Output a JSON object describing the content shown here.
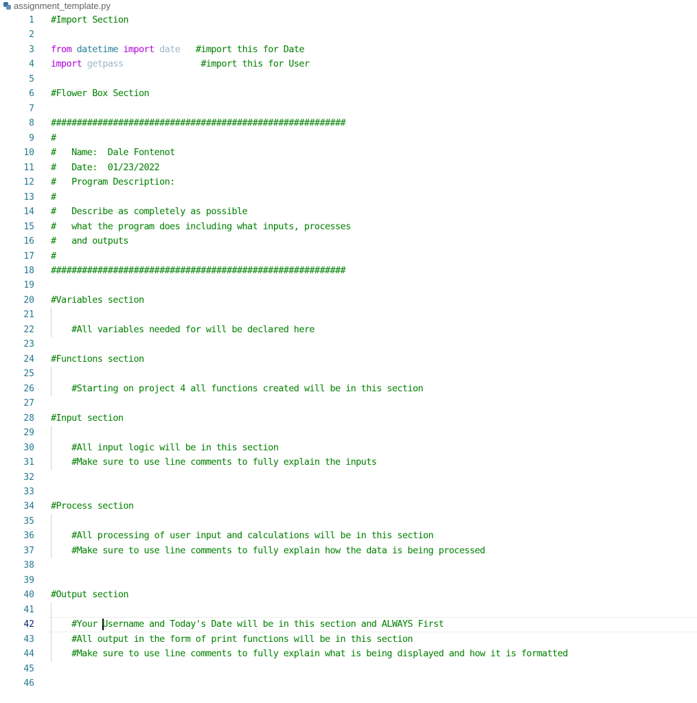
{
  "tab": {
    "icon": "python-file-icon",
    "title": "assignment_template.py"
  },
  "colors": {
    "comment": "#008000",
    "keyword": "#af00db",
    "module": "#267f99",
    "line_number": "#237893"
  },
  "cursor": {
    "line": 42,
    "column": 10
  },
  "lines": [
    {
      "n": "1",
      "parts": [
        {
          "t": "#Import Section",
          "c": "cmt"
        }
      ]
    },
    {
      "n": "2",
      "parts": []
    },
    {
      "n": "3",
      "parts": [
        {
          "t": "from",
          "c": "kw"
        },
        {
          "t": " datetime ",
          "c": "mod"
        },
        {
          "t": "import",
          "c": "kw"
        },
        {
          "t": " ",
          "c": ""
        },
        {
          "t": "date",
          "c": "dim"
        },
        {
          "t": "   ",
          "c": ""
        },
        {
          "t": "#import this for Date",
          "c": "cmt"
        }
      ]
    },
    {
      "n": "4",
      "parts": [
        {
          "t": "import",
          "c": "kw"
        },
        {
          "t": " ",
          "c": ""
        },
        {
          "t": "getpass",
          "c": "dim"
        },
        {
          "t": "               ",
          "c": ""
        },
        {
          "t": "#import this for User",
          "c": "cmt"
        }
      ]
    },
    {
      "n": "5",
      "parts": []
    },
    {
      "n": "6",
      "parts": [
        {
          "t": "#Flower Box Section",
          "c": "cmt"
        }
      ]
    },
    {
      "n": "7",
      "parts": []
    },
    {
      "n": "8",
      "parts": [
        {
          "t": "#########################################################",
          "c": "cmt"
        }
      ]
    },
    {
      "n": "9",
      "parts": [
        {
          "t": "#",
          "c": "cmt"
        }
      ]
    },
    {
      "n": "10",
      "parts": [
        {
          "t": "#   Name:  Dale Fontenot",
          "c": "cmt"
        }
      ]
    },
    {
      "n": "11",
      "parts": [
        {
          "t": "#   Date:  01/23/2022",
          "c": "cmt"
        }
      ]
    },
    {
      "n": "12",
      "parts": [
        {
          "t": "#   Program Description:",
          "c": "cmt"
        }
      ]
    },
    {
      "n": "13",
      "parts": [
        {
          "t": "#",
          "c": "cmt"
        }
      ]
    },
    {
      "n": "14",
      "parts": [
        {
          "t": "#   Describe as completely as possible",
          "c": "cmt"
        }
      ]
    },
    {
      "n": "15",
      "parts": [
        {
          "t": "#   what the program does including what inputs, processes",
          "c": "cmt"
        }
      ]
    },
    {
      "n": "16",
      "parts": [
        {
          "t": "#   and outputs",
          "c": "cmt"
        }
      ]
    },
    {
      "n": "17",
      "parts": [
        {
          "t": "#",
          "c": "cmt"
        }
      ]
    },
    {
      "n": "18",
      "parts": [
        {
          "t": "#########################################################",
          "c": "cmt"
        }
      ]
    },
    {
      "n": "19",
      "parts": []
    },
    {
      "n": "20",
      "parts": [
        {
          "t": "#Variables section",
          "c": "cmt"
        }
      ]
    },
    {
      "n": "21",
      "parts": [],
      "guide": true
    },
    {
      "n": "22",
      "parts": [
        {
          "t": "    #All variables needed for will be declared here",
          "c": "cmt"
        }
      ],
      "guide": true
    },
    {
      "n": "23",
      "parts": []
    },
    {
      "n": "24",
      "parts": [
        {
          "t": "#Functions section",
          "c": "cmt"
        }
      ]
    },
    {
      "n": "25",
      "parts": [],
      "guide": true
    },
    {
      "n": "26",
      "parts": [
        {
          "t": "    #Starting on project 4 all functions created will be in this section",
          "c": "cmt"
        }
      ],
      "guide": true
    },
    {
      "n": "27",
      "parts": []
    },
    {
      "n": "28",
      "parts": [
        {
          "t": "#Input section",
          "c": "cmt"
        }
      ]
    },
    {
      "n": "29",
      "parts": [],
      "guide": true
    },
    {
      "n": "30",
      "parts": [
        {
          "t": "    #All input logic will be in this section",
          "c": "cmt"
        }
      ],
      "guide": true
    },
    {
      "n": "31",
      "parts": [
        {
          "t": "    #Make sure to use line comments to fully explain the inputs",
          "c": "cmt"
        }
      ],
      "guide": true
    },
    {
      "n": "32",
      "parts": []
    },
    {
      "n": "33",
      "parts": []
    },
    {
      "n": "34",
      "parts": [
        {
          "t": "#Process section",
          "c": "cmt"
        }
      ]
    },
    {
      "n": "35",
      "parts": [],
      "guide": true
    },
    {
      "n": "36",
      "parts": [
        {
          "t": "    #All processing of user input and calculations will be in this section",
          "c": "cmt"
        }
      ],
      "guide": true
    },
    {
      "n": "37",
      "parts": [
        {
          "t": "    #Make sure to use line comments to fully explain how the data is being processed",
          "c": "cmt"
        }
      ],
      "guide": true
    },
    {
      "n": "38",
      "parts": []
    },
    {
      "n": "39",
      "parts": []
    },
    {
      "n": "40",
      "parts": [
        {
          "t": "#Output section",
          "c": "cmt"
        }
      ]
    },
    {
      "n": "41",
      "parts": [],
      "guide": true
    },
    {
      "n": "42",
      "parts": [
        {
          "t": "    #Your ",
          "c": "cmt"
        },
        {
          "t": "",
          "c": "cursor"
        },
        {
          "t": "Username and Today's Date will be in this section and ALWAYS First",
          "c": "cmt"
        }
      ],
      "guide": true,
      "active": true
    },
    {
      "n": "43",
      "parts": [
        {
          "t": "    #All output in the form of print functions will be in this section",
          "c": "cmt"
        }
      ],
      "guide": true
    },
    {
      "n": "44",
      "parts": [
        {
          "t": "    #Make sure to use line comments to fully explain what is being displayed and how it is formatted",
          "c": "cmt"
        }
      ],
      "guide": true
    },
    {
      "n": "45",
      "parts": []
    },
    {
      "n": "46",
      "parts": []
    }
  ]
}
